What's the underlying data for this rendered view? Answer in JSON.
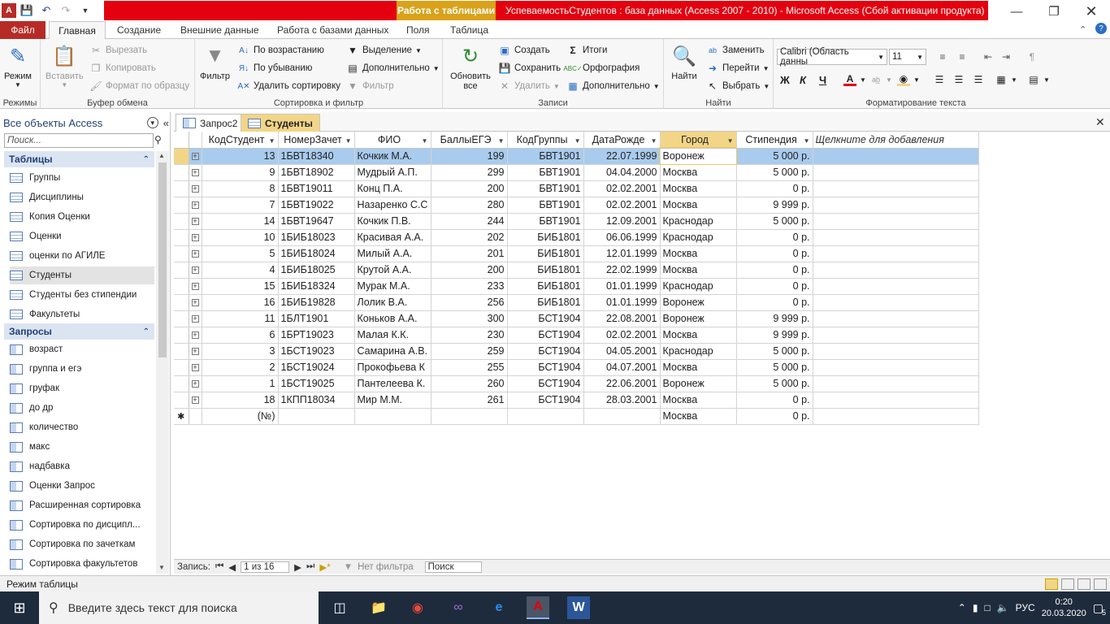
{
  "window": {
    "title": "УспеваемостьСтудентов : база данных (Access 2007 - 2010)  -  Microsoft Access (Сбой активации продукта)",
    "context_tab": "Работа с таблицами"
  },
  "ribbon_tabs": [
    "Файл",
    "Главная",
    "Создание",
    "Внешние данные",
    "Работа с базами данных",
    "Поля",
    "Таблица"
  ],
  "ribbon": {
    "modes": {
      "view_label": "Режим",
      "group": "Режимы"
    },
    "clipboard": {
      "paste": "Вставить",
      "cut": "Вырезать",
      "copy": "Копировать",
      "format_painter": "Формат по образцу",
      "group": "Буфер обмена"
    },
    "sort_filter": {
      "filter": "Фильтр",
      "asc": "По возрастанию",
      "desc": "По убыванию",
      "remove_sort": "Удалить сортировку",
      "selection": "Выделение",
      "advanced": "Дополнительно",
      "toggle_filter": "Фильтр",
      "group": "Сортировка и фильтр"
    },
    "records": {
      "refresh": "Обновить все",
      "new": "Создать",
      "save": "Сохранить",
      "delete": "Удалить",
      "totals": "Итоги",
      "spelling": "Орфография",
      "more": "Дополнительно",
      "group": "Записи"
    },
    "find": {
      "find": "Найти",
      "replace": "Заменить",
      "goto": "Перейти",
      "select": "Выбрать",
      "group": "Найти"
    },
    "text_format": {
      "font": "Calibri (Область данны",
      "size": "11",
      "bold": "Ж",
      "italic": "К",
      "underline": "Ч",
      "group": "Форматирование текста"
    }
  },
  "nav": {
    "header": "Все объекты Access",
    "search_placeholder": "Поиск...",
    "tables_header": "Таблицы",
    "tables": [
      "Группы",
      "Дисциплины",
      "Копия Оценки",
      "Оценки",
      "оценки по АГИЛЕ",
      "Студенты",
      "Студенты без стипендии",
      "Факультеты"
    ],
    "queries_header": "Запросы",
    "queries": [
      "возраст",
      "группа и егэ",
      "груфак",
      "до др",
      "количество",
      "макс",
      "надбавка",
      "Оценки Запрос",
      "Расширенная сортировка",
      "Сортировка по дисципл...",
      "Сортировка по зачеткам",
      "Сортировка факультетов"
    ]
  },
  "doc_tabs": [
    "Запрос2",
    "Студенты"
  ],
  "table": {
    "columns": [
      "КодСтудент",
      "НомерЗачет",
      "ФИО",
      "БаллыЕГЭ",
      "КодГруппы",
      "ДатаРожде",
      "Город",
      "Стипендия",
      "Щелкните для добавления"
    ],
    "rows": [
      [
        "13",
        "1БВТ18340",
        "Кочкик М.А.",
        "199",
        "БВТ1901",
        "22.07.1999",
        "Воронеж",
        "5 000 р."
      ],
      [
        "9",
        "1БВТ18902",
        "Мудрый А.П.",
        "299",
        "БВТ1901",
        "04.04.2000",
        "Москва",
        "5 000 р."
      ],
      [
        "8",
        "1БВТ19011",
        "Конц П.А.",
        "200",
        "БВТ1901",
        "02.02.2001",
        "Москва",
        "0 р."
      ],
      [
        "7",
        "1БВТ19022",
        "Назаренко С.С",
        "280",
        "БВТ1901",
        "02.02.2001",
        "Москва",
        "9 999 р."
      ],
      [
        "14",
        "1БВТ19647",
        "Кочкик П.В.",
        "244",
        "БВТ1901",
        "12.09.2001",
        "Краснодар",
        "5 000 р."
      ],
      [
        "10",
        "1БИБ18023",
        "Красивая А.А.",
        "202",
        "БИБ1801",
        "06.06.1999",
        "Краснодар",
        "0 р."
      ],
      [
        "5",
        "1БИБ18024",
        "Милый А.А.",
        "201",
        "БИБ1801",
        "12.01.1999",
        "Москва",
        "0 р."
      ],
      [
        "4",
        "1БИБ18025",
        "Крутой А.А.",
        "200",
        "БИБ1801",
        "22.02.1999",
        "Москва",
        "0 р."
      ],
      [
        "15",
        "1БИБ18324",
        "Мурак М.А.",
        "233",
        "БИБ1801",
        "01.01.1999",
        "Краснодар",
        "0 р."
      ],
      [
        "16",
        "1БИБ19828",
        "Лолик В.А.",
        "256",
        "БИБ1801",
        "01.01.1999",
        "Воронеж",
        "0 р."
      ],
      [
        "11",
        "1БЛТ1901",
        "Коньков А.А.",
        "300",
        "БСТ1904",
        "22.08.2001",
        "Воронеж",
        "9 999 р."
      ],
      [
        "6",
        "1БРТ19023",
        "Малая К.К.",
        "230",
        "БСТ1904",
        "02.02.2001",
        "Москва",
        "9 999 р."
      ],
      [
        "3",
        "1БСТ19023",
        "Самарина А.В.",
        "259",
        "БСТ1904",
        "04.05.2001",
        "Краснодар",
        "5 000 р."
      ],
      [
        "2",
        "1БСТ19024",
        "Прокофьева К",
        "255",
        "БСТ1904",
        "04.07.2001",
        "Москва",
        "5 000 р."
      ],
      [
        "1",
        "1БСТ19025",
        "Пантелеева К.",
        "260",
        "БСТ1904",
        "22.06.2001",
        "Воронеж",
        "5 000 р."
      ],
      [
        "18",
        "1КПП18034",
        "Мир М.М.",
        "261",
        "БСТ1904",
        "28.03.2001",
        "Москва",
        "0 р."
      ]
    ],
    "new_row": {
      "id": "(№)",
      "city": "Москва",
      "stipend": "0 р."
    }
  },
  "record_nav": {
    "label": "Запись:",
    "position": "1 из 16",
    "filter": "Нет фильтра",
    "search": "Поиск"
  },
  "status": {
    "mode": "Режим таблицы"
  },
  "taskbar": {
    "search_placeholder": "Введите здесь текст для поиска",
    "lang": "РУС",
    "time": "0:20",
    "date": "20.03.2020",
    "notif_count": "5"
  },
  "colors": {
    "accent_red": "#e3010f",
    "context_gold": "#d9a21a",
    "selected_row": "#a9cbee",
    "active_tab": "#f3d587"
  }
}
